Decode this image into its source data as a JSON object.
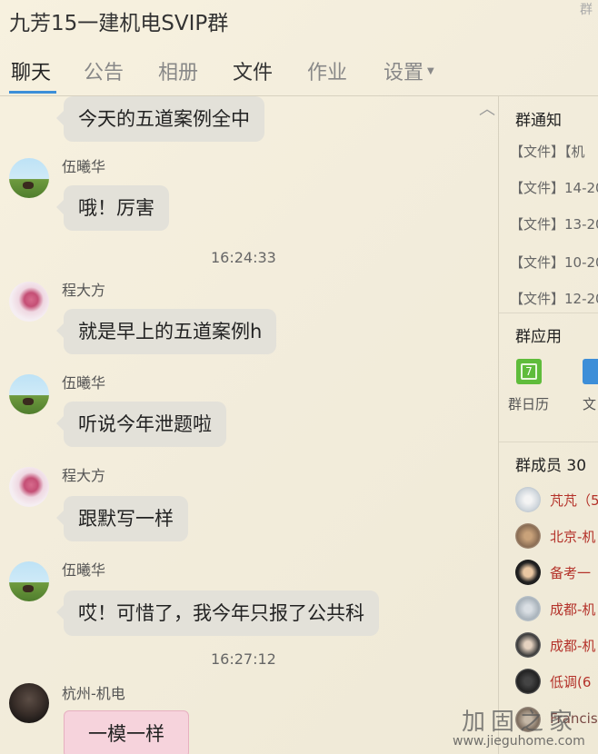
{
  "window": {
    "title": "九芳15一建机电SVIP群",
    "corner_text": "群"
  },
  "tabs": [
    {
      "label": "聊天"
    },
    {
      "label": "公告"
    },
    {
      "label": "相册"
    },
    {
      "label": "文件"
    },
    {
      "label": "作业"
    },
    {
      "label": "设置"
    }
  ],
  "chat": {
    "messages": [
      {
        "sender": "",
        "text": "今天的五道案例全中"
      },
      {
        "sender": "伍曦华",
        "text": "哦！厉害"
      },
      {
        "time": "16:24:33"
      },
      {
        "sender": "程大方",
        "text": "就是早上的五道案例h"
      },
      {
        "sender": "伍曦华",
        "text": "听说今年泄题啦"
      },
      {
        "sender": "程大方",
        "text": "跟默写一样"
      },
      {
        "sender": "伍曦华",
        "text": "哎！可惜了，我今年只报了公共科"
      },
      {
        "time": "16:27:12"
      },
      {
        "sender": "杭州-机电",
        "text": "一模一样"
      }
    ]
  },
  "side": {
    "notice_title": "群通知",
    "notices": [
      "【文件】【机",
      "【文件】14-20",
      "【文件】13-20",
      "【文件】10-20",
      "【文件】12-20"
    ],
    "apps_title": "群应用",
    "apps": [
      {
        "label": "群日历",
        "icon": "calendar-icon"
      },
      {
        "label": "文",
        "icon": "document-icon"
      }
    ],
    "members_title": "群成员 30",
    "members": [
      {
        "name": "芃芃（5"
      },
      {
        "name": "北京-机"
      },
      {
        "name": "备考一"
      },
      {
        "name": "成都-机"
      },
      {
        "name": "成都-机"
      },
      {
        "name": "低调(6"
      },
      {
        "name": "Francis"
      }
    ]
  },
  "watermark": {
    "main": "加固之家",
    "url": "www.jieguhome.com"
  },
  "colors": {
    "accent": "#3c8fd8",
    "bubble": "#e3e1d9",
    "member_name": "#b4322a"
  }
}
